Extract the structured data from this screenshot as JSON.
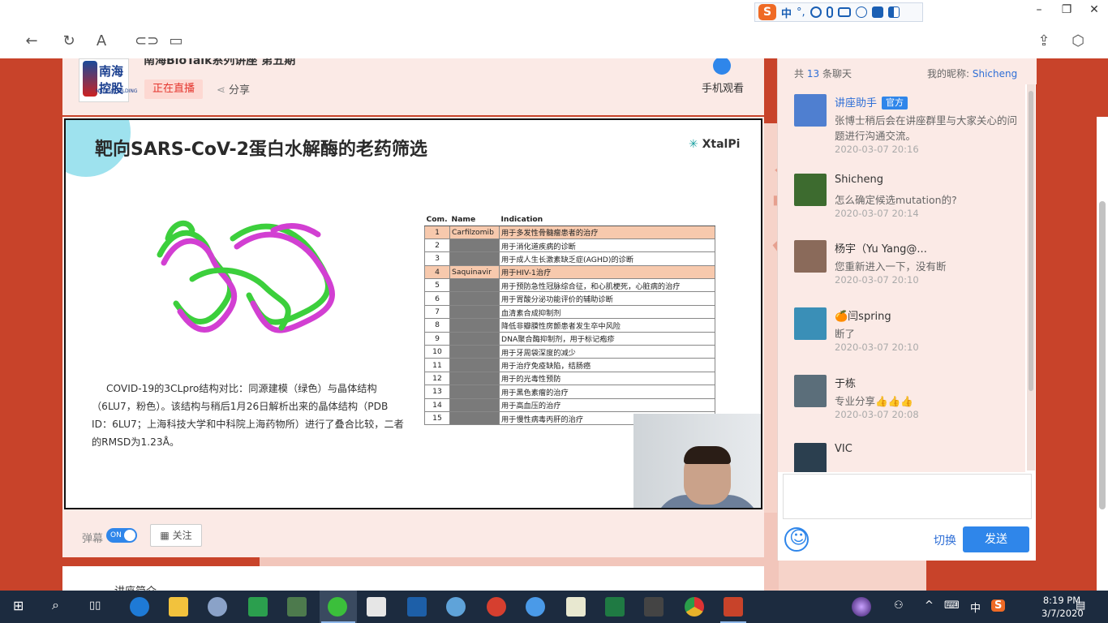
{
  "ime": {
    "logo": "S",
    "lang": "中",
    "punct": "°,"
  },
  "window_controls": {
    "minimize": "–",
    "restore": "❐",
    "close": "✕"
  },
  "header": {
    "title": "南海BioTalk系列讲座 第五期",
    "logo_text": "南海控股",
    "logo_sub": "NANHAIHOLDING",
    "live_label": "正在直播",
    "share_label": "分享",
    "mobile_label": "手机观看"
  },
  "slide": {
    "title": "靶向SARS-CoV-2蛋白水解酶的老药筛选",
    "brand": "XtalPi",
    "caption": "COVID-19的3CLpro结构对比：同源建模（绿色）与晶体结构（6LU7，粉色）。该结构与稍后1月26日解析出来的晶体结构（PDB ID：6LU7；上海科技大学和中科院上海药物所）进行了叠合比较，二者的RMSD为1.23Å。",
    "table": {
      "headers": [
        "Com.",
        "Name",
        "Indication"
      ],
      "rows": [
        {
          "num": "1",
          "name": "Carfilzomib",
          "indication": "用于多发性骨髓瘤患者的治疗",
          "highlight": true
        },
        {
          "num": "2",
          "name": "",
          "indication": "用于消化道疾病的诊断",
          "highlight": false
        },
        {
          "num": "3",
          "name": "",
          "indication": "用于成人生长激素缺乏症(AGHD)的诊断",
          "highlight": false
        },
        {
          "num": "4",
          "name": "Saquinavir",
          "indication": "用于HIV-1治疗",
          "highlight": true
        },
        {
          "num": "5",
          "name": "",
          "indication": "用于预防急性冠脉综合征，和心肌梗死，心脏病的治疗",
          "highlight": false
        },
        {
          "num": "6",
          "name": "",
          "indication": "用于胃酸分泌功能评价的辅助诊断",
          "highlight": false
        },
        {
          "num": "7",
          "name": "",
          "indication": "血清素合成抑制剂",
          "highlight": false
        },
        {
          "num": "8",
          "name": "",
          "indication": "降低非瓣膜性房颤患者发生卒中风险",
          "highlight": false
        },
        {
          "num": "9",
          "name": "",
          "indication": "DNA聚合酶抑制剂，用于标记疱疹",
          "highlight": false
        },
        {
          "num": "10",
          "name": "",
          "indication": "用于牙周袋深度的减少",
          "highlight": false
        },
        {
          "num": "11",
          "name": "",
          "indication": "用于治疗免疫缺陷，结肠癌",
          "highlight": false
        },
        {
          "num": "12",
          "name": "",
          "indication": "用于的光毒性预防",
          "highlight": false
        },
        {
          "num": "13",
          "name": "",
          "indication": "用于黑色素瘤的治疗",
          "highlight": false
        },
        {
          "num": "14",
          "name": "",
          "indication": "用于高血压的治疗",
          "highlight": false
        },
        {
          "num": "15",
          "name": "",
          "indication": "用于慢性病毒丙肝的治疗",
          "highlight": false
        }
      ]
    }
  },
  "controls": {
    "danmu_label": "弹幕",
    "danmu_state": "ON",
    "follow_label": "关注"
  },
  "below": {
    "text": "讲座简介"
  },
  "chat": {
    "count_prefix": "共",
    "count": "13",
    "count_suffix": "条聊天",
    "nick_label": "我的昵称:",
    "nick_value": "Shicheng",
    "messages": [
      {
        "name": "讲座助手",
        "badge": "官方",
        "text": "张博士稍后会在讲座群里与大家关心的问题进行沟通交流。",
        "time": "2020-03-07 20:16",
        "official": true
      },
      {
        "name": "Shicheng",
        "badge": "",
        "text": "怎么确定候选mutation的?",
        "time": "2020-03-07 20:14",
        "official": false
      },
      {
        "name": "杨宇（Yu Yang@...",
        "badge": "",
        "text": "您重新进入一下，没有断",
        "time": "2020-03-07 20:10",
        "official": false
      },
      {
        "name": "🍊闫spring",
        "badge": "",
        "text": "断了",
        "time": "2020-03-07 20:10",
        "official": false
      },
      {
        "name": "于栋",
        "badge": "",
        "text": "专业分享👍👍👍",
        "time": "2020-03-07 20:08",
        "official": false
      },
      {
        "name": "VIC",
        "badge": "",
        "text": "",
        "time": "",
        "official": false
      }
    ],
    "switch_label": "切换",
    "send_label": "发送"
  },
  "taskbar": {
    "time": "8:19 PM",
    "date": "3/7/2020",
    "lang": "中",
    "ime_logo": "S"
  },
  "colors": {
    "accent": "#2f86ea",
    "live": "#e4352d",
    "page_bg": "#c8432a",
    "highlight_row": "#f7c9ad"
  }
}
